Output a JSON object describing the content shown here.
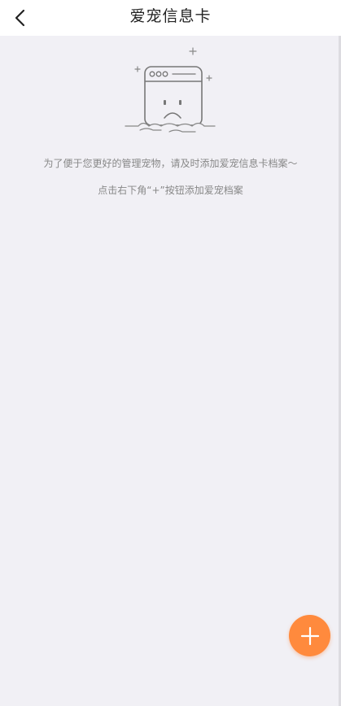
{
  "header": {
    "title": "爱宠信息卡",
    "back_icon": "chevron-left-icon"
  },
  "empty_state": {
    "illustration_icon": "sad-browser-window-icon",
    "line1": "为了便于您更好的管理宠物，请及时添加爱宠信息卡档案～",
    "line2": "点击右下角“+”按钮添加爱宠档案"
  },
  "fab": {
    "icon": "plus-icon",
    "color": "#ff8a3d"
  },
  "colors": {
    "background": "#f1f0f5",
    "header_background": "#ffffff",
    "text_muted": "#888888"
  }
}
